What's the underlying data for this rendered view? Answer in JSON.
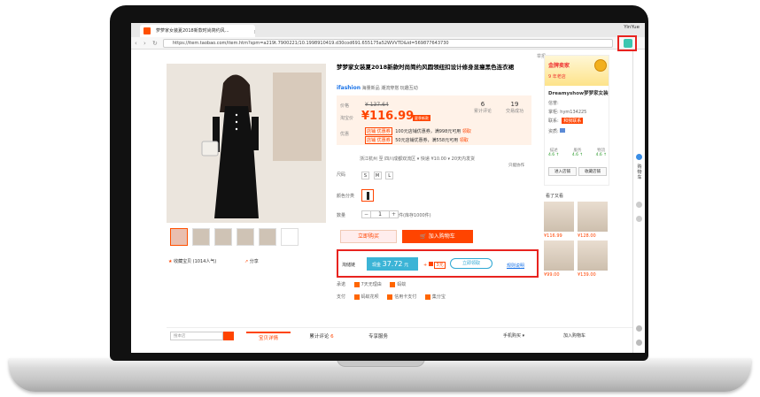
{
  "browser": {
    "tab_title": "萝萝家女装夏2018新款时尚简约风...",
    "user_name": "YinYue",
    "url": "https://item.taobao.com/item.htm?spm=a219t.7900221/10.1998910419.d30cod691.655175a52WVVTD&id=569877643730"
  },
  "product": {
    "title": "梦梦家女装夏2018新款时尚简约风圆领纽扣设计修身显瘦黑色连衣裙",
    "report": "举报",
    "brand_logo": "ifashion",
    "brand_tags": "海量新品  潮流穿搭  玩趣互动",
    "price_label": "价格",
    "old_price": "¥ 137.64",
    "promo_label": "淘宝价",
    "price": "¥116.99",
    "price_tag": "夏季新款",
    "reviews_count": "6",
    "reviews_label": "累计评论",
    "sales_count": "19",
    "sales_label": "交易成功",
    "coupon_label": "优惠",
    "coupons": [
      {
        "tag": "店铺 优惠券",
        "text": "100元店铺优惠券，满998元可用",
        "action": "领取"
      },
      {
        "tag": "店铺 优惠券",
        "text": "50元店铺优惠券，满558元可用",
        "action": "领取"
      }
    ],
    "shipping": "浙江杭州 至  四川成都双流区 ▾   快递 ¥10.00 ▾     20天内发货",
    "shipping_note": "只能协作",
    "size_label": "尺码",
    "sizes": [
      "S",
      "M",
      "L"
    ],
    "color_label": "颜色分类",
    "qty_label": "数量",
    "qty_minus": "−",
    "qty_value": "1",
    "qty_plus": "+",
    "stock": "件(库存1000件)",
    "buy_now": "立即购买",
    "add_cart": "加入购物车",
    "favorite": "收藏宝贝 (1014人气)",
    "share": "分享"
  },
  "huangou": {
    "label": "淘储链",
    "badge": "现金",
    "amount": "37.72",
    "unit": "元",
    "plus": "+",
    "extra": "3元",
    "get": "立即领取",
    "rules": "规则说明"
  },
  "services": {
    "commit_label": "承诺",
    "commit_items": [
      "7天无理由",
      "蚂蚁"
    ],
    "pay_label": "支付",
    "pay_items": [
      "蚂蚁花呗",
      "信用卡支付",
      "集分宝"
    ]
  },
  "shop": {
    "gold_seller": "金牌卖家",
    "years": "9 年老店",
    "name": "Dreamyshow梦梦家女装",
    "rank_label": "信誉:",
    "owner_label": "掌柜:",
    "owner": "hym134225",
    "contact_label": "联系:",
    "contact": "和我联系",
    "qual_label": "资质:",
    "scores": [
      {
        "label": "描述",
        "value": "4.6 ↑"
      },
      {
        "label": "服务",
        "value": "4.6 ↑"
      },
      {
        "label": "物流",
        "value": "4.6 ↑"
      }
    ],
    "enter_shop": "进入店铺",
    "fav_shop": "收藏店铺",
    "watched_title": "看了又看",
    "watched_prices": [
      "¥116.99",
      "¥128.00",
      "¥99.00",
      "¥139.00"
    ]
  },
  "sidebar": {
    "cart": "购物车"
  },
  "bottom_tabs": {
    "search_placeholder": "搜本店",
    "detail": "宝贝详情",
    "reviews": "累计评论",
    "reviews_count": "6",
    "service": "专享服务",
    "mobile": "手机购买 ▾",
    "add_cart": "加入购物车"
  },
  "colors": {
    "accent": "#ff4400",
    "highlight_box": "#e8231f",
    "huangou_blue": "#3cb4d6"
  }
}
